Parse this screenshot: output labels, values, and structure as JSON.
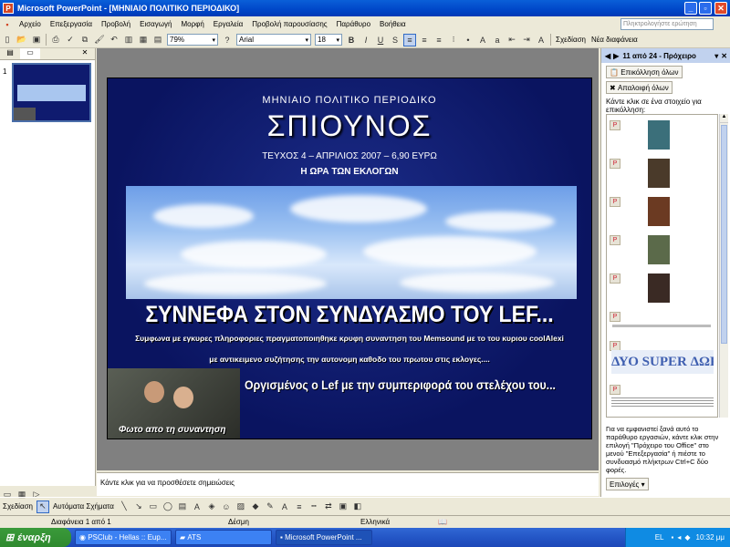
{
  "window": {
    "title": "Microsoft PowerPoint - [ΜΗΝΙΑΙΟ ΠΟΛΙΤΙΚΟ ΠΕΡΙΟΔΙΚΟ]"
  },
  "menu": [
    "Αρχείο",
    "Επεξεργασία",
    "Προβολή",
    "Εισαγωγή",
    "Μορφή",
    "Εργαλεία",
    "Προβολή παρουσίασης",
    "Παράθυρο",
    "Βοήθεια"
  ],
  "help_placeholder": "Πληκτρολογήστε ερώτηση",
  "toolbar": {
    "zoom": "79%",
    "font": "Arial",
    "size": "18",
    "design": "Σχεδίαση",
    "new_slide": "Νέα διαφάνεια"
  },
  "slide_panel": {
    "number": "1"
  },
  "slide": {
    "subtitle": "ΜΗΝΙΑΙΟ ΠΟΛΙΤΙΚΟ ΠΕΡΙΟΔΙΚΟ",
    "title": "ΣΠΙΟΥΝΟΣ",
    "issue": "ΤΕΥΧΟΣ 4 – ΑΠΡΙΛΙΟΣ 2007 – 6,90 ΕΥΡΩ",
    "tagline": "Η ΩΡΑ ΤΩΝ ΕΚΛΟΓΩΝ",
    "headline": "ΣΥΝΝΕΦΑ ΣΤΟΝ ΣΥΝΔΥΑΣΜΟ ΤΟΥ LEF...",
    "line1": "Συμφωνα με εγκυρες πληροφοριες πραγματοποιηθηκε κρυφη συναντηση του Memsound με το του κυριου coolAlexi",
    "line2": "με αντικειμενο συζήτησης την αυτονομη καθοδο του πρωτου στις εκλογες....",
    "quote": "Οργισμένος ο Lef με την συμπεριφορά του στελέχου του...",
    "photo_caption": "Φωτο απο τη συναντηση"
  },
  "notes_placeholder": "Κάντε κλικ για να προσθέσετε σημειώσεις",
  "clipboard": {
    "header": "11 από 24 - Πρόχειρο",
    "paste_all": "Επικόλληση όλων",
    "clear_all": "Απαλοιφή όλων",
    "instruction": "Κάντε κλικ σε ένα στοιχείο για επικόλληση:",
    "wordart_text": "ΔΥΟ SUPER ΔΩΡΑ",
    "footer": "Για να εμφανιστεί ξανά αυτό το παράθυρο εργασιών, κάντε κλικ στην επιλογή \"Πρόχειρο του Office\" στο μενού \"Επεξεργασία\" ή πιέστε το συνδυασμό πλήκτρων Ctrl+C δύο φορές.",
    "options": "Επιλογές"
  },
  "drawing": {
    "draw": "Σχεδίαση",
    "autoshapes": "Αυτόματα Σχήματα"
  },
  "status": {
    "slide": "Διαφάνεια 1 από 1",
    "design": "Δέσμη",
    "language": "Ελληνικά"
  },
  "taskbar": {
    "start": "έναρξη",
    "tasks": [
      "PSClub - Hellas :: Eup...",
      "ATS",
      "Microsoft PowerPoint ..."
    ],
    "lang": "EL",
    "time": "10:32 μμ"
  }
}
